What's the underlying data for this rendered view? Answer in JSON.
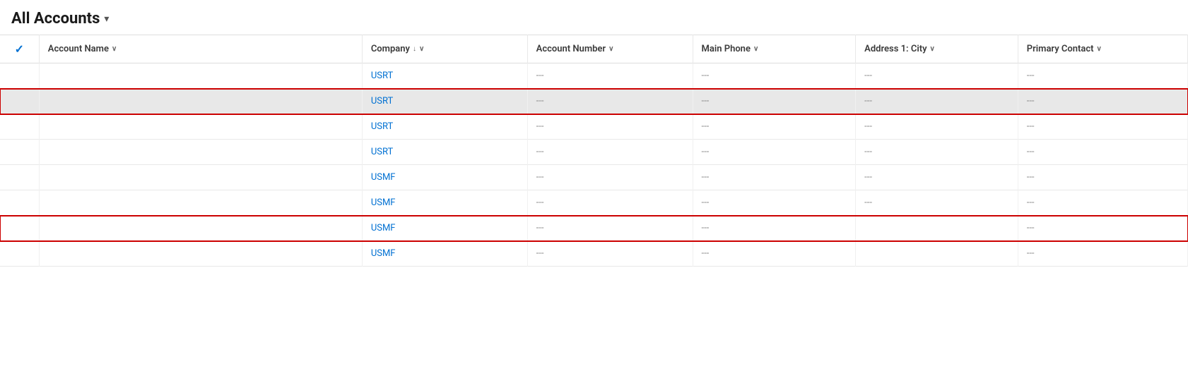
{
  "header": {
    "title": "All Accounts",
    "chevron": "▾"
  },
  "columns": [
    {
      "id": "check",
      "label": "",
      "sortable": false
    },
    {
      "id": "account-name",
      "label": "Account Name",
      "sortable": true,
      "sortDir": ""
    },
    {
      "id": "company",
      "label": "Company",
      "sortable": true,
      "sortDir": "desc"
    },
    {
      "id": "account-number",
      "label": "Account Number",
      "sortable": true,
      "sortDir": ""
    },
    {
      "id": "main-phone",
      "label": "Main Phone",
      "sortable": true,
      "sortDir": ""
    },
    {
      "id": "address-city",
      "label": "Address 1: City",
      "sortable": true,
      "sortDir": ""
    },
    {
      "id": "primary-contact",
      "label": "Primary Contact",
      "sortable": true,
      "sortDir": ""
    }
  ],
  "rows": [
    {
      "id": "r1",
      "check": false,
      "accountName": "",
      "company": "USRT",
      "accountNumber": "---",
      "mainPhone": "---",
      "addressCity": "---",
      "primaryContact": "---",
      "highlighted": false,
      "outlined": false,
      "partialLeft": false
    },
    {
      "id": "r2",
      "check": false,
      "accountName": "",
      "company": "USRT",
      "accountNumber": "---",
      "mainPhone": "---",
      "addressCity": "---",
      "primaryContact": "---",
      "highlighted": true,
      "outlined": false,
      "partialLeft": false
    },
    {
      "id": "r3",
      "check": false,
      "accountName": "",
      "company": "USRT",
      "accountNumber": "---",
      "mainPhone": "---",
      "addressCity": "---",
      "primaryContact": "---",
      "highlighted": false,
      "outlined": false,
      "partialLeft": true
    },
    {
      "id": "r4",
      "check": false,
      "accountName": "",
      "company": "USRT",
      "accountNumber": "---",
      "mainPhone": "---",
      "addressCity": "---",
      "primaryContact": "---",
      "highlighted": false,
      "outlined": false,
      "partialLeft": true
    },
    {
      "id": "r5",
      "check": false,
      "accountName": "",
      "company": "USMF",
      "accountNumber": "---",
      "mainPhone": "---",
      "addressCity": "---",
      "primaryContact": "---",
      "highlighted": false,
      "outlined": false,
      "partialLeft": true
    },
    {
      "id": "r6",
      "check": false,
      "accountName": "",
      "company": "USMF",
      "accountNumber": "---",
      "mainPhone": "---",
      "addressCity": "---",
      "primaryContact": "---",
      "highlighted": false,
      "outlined": false,
      "partialLeft": true
    },
    {
      "id": "r7",
      "check": false,
      "accountName": "",
      "company": "USMF",
      "accountNumber": "---",
      "mainPhone": "---",
      "addressCity": "",
      "primaryContact": "---",
      "highlighted": false,
      "outlined": true,
      "partialLeft": false
    },
    {
      "id": "r8",
      "check": false,
      "accountName": "",
      "company": "USMF",
      "accountNumber": "---",
      "mainPhone": "---",
      "addressCity": "",
      "primaryContact": "---",
      "highlighted": false,
      "outlined": false,
      "partialLeft": false
    }
  ],
  "empty_value": "---"
}
